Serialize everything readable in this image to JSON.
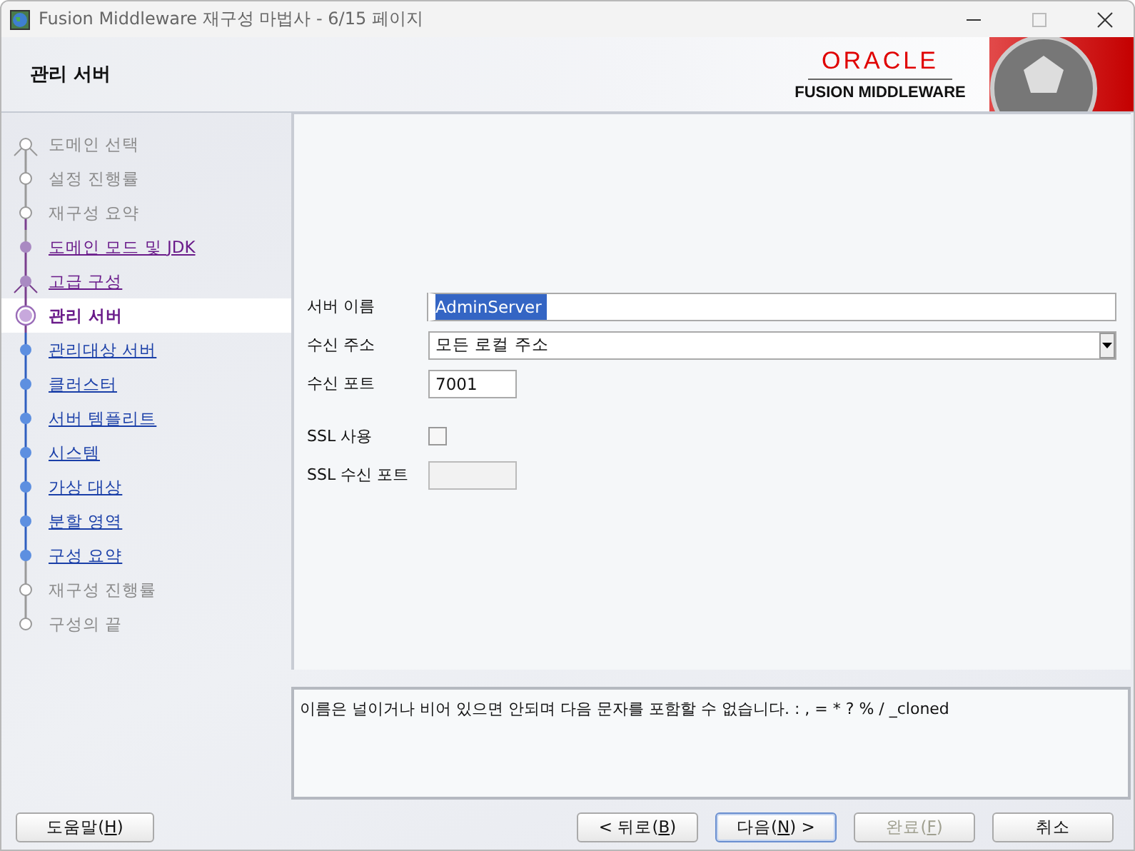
{
  "window": {
    "title": "Fusion Middleware 재구성 마법사 - 6/15 페이지"
  },
  "header": {
    "title": "관리 서버",
    "brand": "ORACLE",
    "product": "FUSION MIDDLEWARE"
  },
  "steps": [
    {
      "label": "도메인 선택",
      "kind": "disabled",
      "branch": true
    },
    {
      "label": "설정 진행률",
      "kind": "disabled",
      "branch": false
    },
    {
      "label": "재구성 요약",
      "kind": "disabled",
      "branch": false
    },
    {
      "label": "도메인 모드 및 JDK",
      "kind": "visited",
      "branch": false
    },
    {
      "label": "고급 구성",
      "kind": "visited",
      "branch": true
    },
    {
      "label": "관리 서버",
      "kind": "current",
      "branch": false
    },
    {
      "label": "관리대상 서버",
      "kind": "available",
      "branch": false
    },
    {
      "label": "클러스터",
      "kind": "available",
      "branch": false
    },
    {
      "label": "서버 템플리트",
      "kind": "available",
      "branch": false
    },
    {
      "label": "시스템",
      "kind": "available",
      "branch": false
    },
    {
      "label": "가상 대상",
      "kind": "available",
      "branch": false
    },
    {
      "label": "분할 영역",
      "kind": "available",
      "branch": false
    },
    {
      "label": "구성 요약",
      "kind": "available",
      "branch": false
    },
    {
      "label": "재구성 진행률",
      "kind": "disabled",
      "branch": false
    },
    {
      "label": "구성의 끝",
      "kind": "disabled",
      "branch": false
    }
  ],
  "server_fields": [
    {
      "kind": "text",
      "label": "서버 이름",
      "value": "AdminServer",
      "wide": true,
      "highlighted": true
    },
    {
      "kind": "select",
      "label": "수신 주소",
      "value": "모든 로컬 주소",
      "wide": true,
      "highlighted": false
    },
    {
      "kind": "text",
      "label": "수신 포트",
      "value": "7001",
      "wide": false,
      "highlighted": false
    }
  ],
  "ssl_fields": [
    {
      "kind": "checkbox",
      "label": "SSL 사용",
      "checked": false
    },
    {
      "kind": "text",
      "label": "SSL 수신 포트",
      "disabled": true
    }
  ],
  "message": "이름은 널이거나 비어 있으면 안되며 다음 문자를 포함할 수 없습니다. : , = * ? % / _cloned",
  "help_button": {
    "text_start": "도움말(",
    "key": "H",
    "text_end": ")"
  },
  "buttons": [
    {
      "text_start": "< 뒤로(",
      "key": "B",
      "text_end": ")",
      "disabled": false,
      "default": false
    },
    {
      "text_start": "다음(",
      "key": "N",
      "text_end": ") >",
      "disabled": false,
      "default": true
    },
    {
      "text_start": "완료(",
      "key": "F",
      "text_end": ")",
      "disabled": true,
      "default": false
    },
    {
      "text_start": "취소",
      "disabled": false,
      "default": false
    }
  ]
}
